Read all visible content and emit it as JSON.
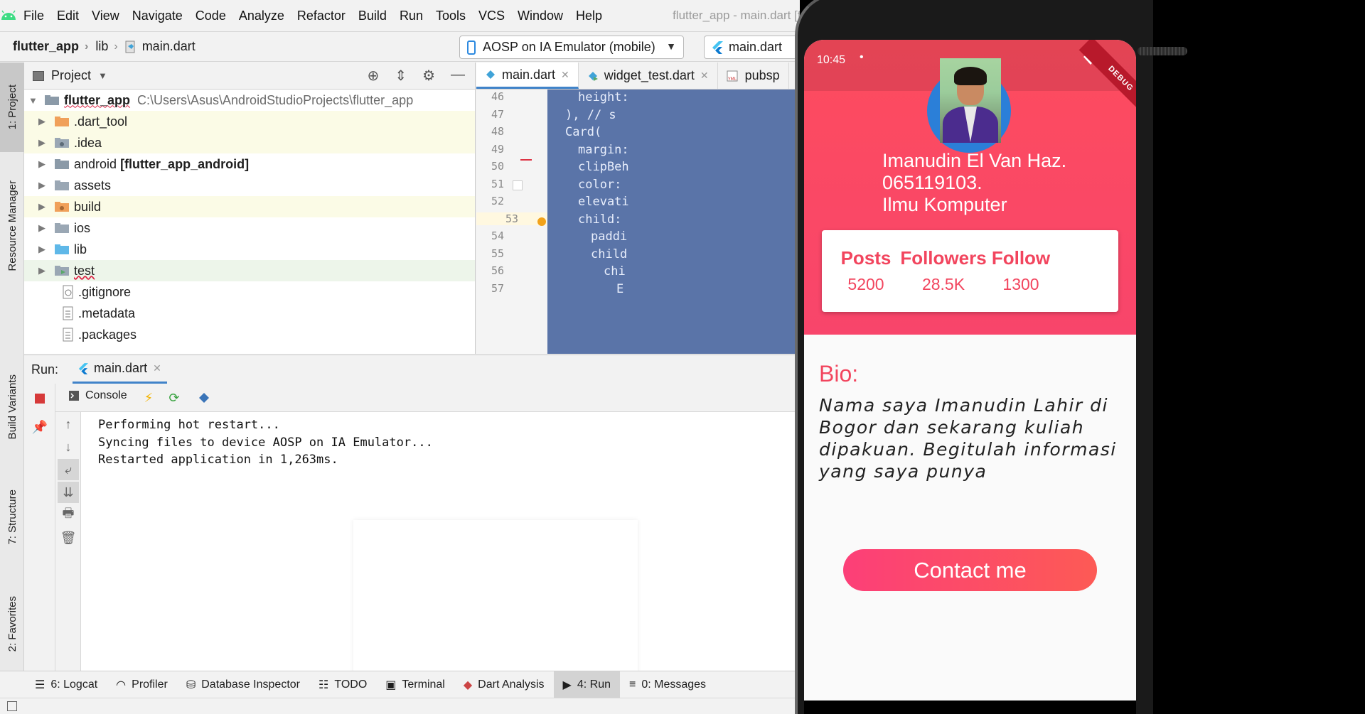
{
  "menubar": {
    "items": [
      "File",
      "Edit",
      "View",
      "Navigate",
      "Code",
      "Analyze",
      "Refactor",
      "Build",
      "Run",
      "Tools",
      "VCS",
      "Window",
      "Help"
    ],
    "window_title": "flutter_app - main.dart [flutter_ap"
  },
  "navbar": {
    "project": "flutter_app",
    "folder": "lib",
    "file": "main.dart",
    "device": "AOSP on IA Emulator (mobile)",
    "run_config": "main.dart"
  },
  "left_strip": {
    "project": "1: Project",
    "resource_manager": "Resource Manager",
    "build_variants": "Build Variants",
    "structure": "7: Structure",
    "favorites": "2: Favorites"
  },
  "project_panel": {
    "title": "Project",
    "root_name": "flutter_app",
    "root_path": "C:\\Users\\Asus\\AndroidStudioProjects\\flutter_app",
    "items": [
      {
        "label": "",
        "name": ".dart_tool"
      },
      {
        "label": "",
        "name": ".idea"
      },
      {
        "label": "android",
        "bold_suffix": "[flutter_app_android]"
      },
      {
        "label": "assets"
      },
      {
        "label": "build"
      },
      {
        "label": "ios"
      },
      {
        "label": "lib"
      },
      {
        "label": "test"
      }
    ],
    "files": [
      ".gitignore",
      ".metadata",
      ".packages"
    ]
  },
  "editor": {
    "tabs": [
      "main.dart",
      "widget_test.dart",
      "pubsp"
    ],
    "line_numbers": [
      "46",
      "47",
      "48",
      "49",
      "50",
      "51",
      "52",
      "53",
      "54",
      "55",
      "56",
      "57"
    ],
    "code_lines": [
      "height:",
      "),  // s",
      "Card(",
      "margin:",
      "clipBeh",
      "color:",
      "elevati",
      "child:",
      "paddi",
      "child",
      "chi",
      "E"
    ]
  },
  "run_panel": {
    "label": "Run:",
    "tab": "main.dart",
    "console": "Console",
    "lines": [
      "Performing hot restart...",
      "Syncing files to device AOSP on IA Emulator...",
      "Restarted application in 1,263ms."
    ]
  },
  "bottom_bar": {
    "items": [
      "6: Logcat",
      "Profiler",
      "Database Inspector",
      "TODO",
      "Terminal",
      "Dart Analysis",
      "4: Run",
      "0: Messages"
    ]
  },
  "phone": {
    "time": "10:45",
    "debug_label": "DEBUG",
    "name_lines": [
      "Imanudin El Van Haz.",
      "065119103.",
      "Ilmu Komputer"
    ],
    "stats": [
      {
        "label": "Posts",
        "value": "5200"
      },
      {
        "label": "Followers",
        "value": "28.5K"
      },
      {
        "label": "Follow",
        "value": "1300"
      }
    ],
    "bio_title": "Bio:",
    "bio_text": "Nama saya Imanudin Lahir di Bogor dan sekarang kuliah dipakuan. Begitulah informasi yang saya punya",
    "contact_button": "Contact me",
    "colors": {
      "header": "#fd4c5e",
      "accent": "#f2455e",
      "avatar_ring": "#2b7fd8"
    }
  }
}
